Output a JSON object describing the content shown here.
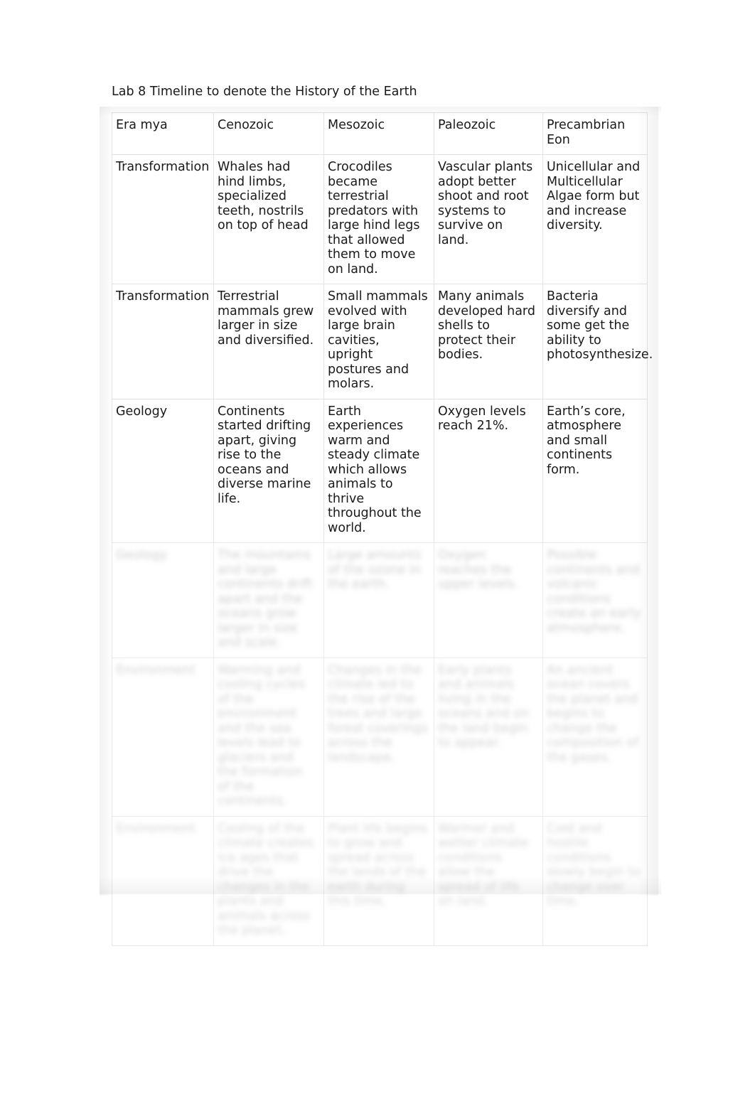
{
  "document": {
    "title": "Lab 8 Timeline to denote the History of the Earth",
    "background_color": "#ffffff",
    "text_color": "#1a1a1a",
    "table_border_color": "#e3e3e3"
  },
  "table": {
    "columns": [
      "Era mya",
      "Cenozoic",
      "Mesozoic",
      "Paleozoic",
      "Precambrian Eon"
    ],
    "rows": [
      {
        "label": "Transformation",
        "obscured": false,
        "cells": [
          "Whales had hind limbs, specialized teeth, nostrils on top of head",
          "Crocodiles became terrestrial predators with large hind legs that allowed them to move on land.",
          "Vascular plants adopt better shoot and root systems to survive on land.",
          "Unicellular and Multicellular Algae form but and increase diversity."
        ]
      },
      {
        "label": "Transformation",
        "obscured": false,
        "cells": [
          "Terrestrial mammals grew larger in size and diversified.",
          "Small mammals evolved with large brain cavities, upright postures and molars.",
          "Many animals developed hard shells to protect their bodies.",
          "Bacteria diversify and some get the ability to photosynthesize."
        ]
      },
      {
        "label": "Geology",
        "obscured": false,
        "cells": [
          "Continents started drifting apart, giving rise to the oceans and diverse marine life.",
          "Earth experiences warm and steady climate which allows animals to thrive throughout the world.",
          "Oxygen levels reach 21%.",
          "Earth’s core, atmosphere and small continents form."
        ]
      },
      {
        "label": "Geology",
        "obscured": true,
        "cells": [
          "The mountains and large continents drift apart and the oceans grow larger in size and scale.",
          "Large amounts of the ozone in the earth.",
          "Oxygen reaches the upper levels.",
          "Possible continents and volcanic conditions create an early atmosphere."
        ]
      },
      {
        "label": "Environment",
        "obscured": true,
        "cells": [
          "Warming and cooling cycles of the environment and the sea levels lead to glaciers and the formation of the continents.",
          "Changes in the climate led to the rise of the trees and large forest coverings across the landscape.",
          "Early plants and animals living in the oceans and on the land begin to appear.",
          "An ancient ocean covers the planet and begins to change the composition of the gases."
        ]
      },
      {
        "label": "Environment",
        "obscured": true,
        "cells": [
          "Cooling of the climate creates ice ages that drive the changes in the plants and animals across the planet.",
          "Plant life begins to grow and spread across the lands of the earth during this time.",
          "Warmer and wetter climate conditions allow the spread of life on land.",
          "Cold and hostile conditions slowly begin to change over time."
        ]
      }
    ]
  }
}
